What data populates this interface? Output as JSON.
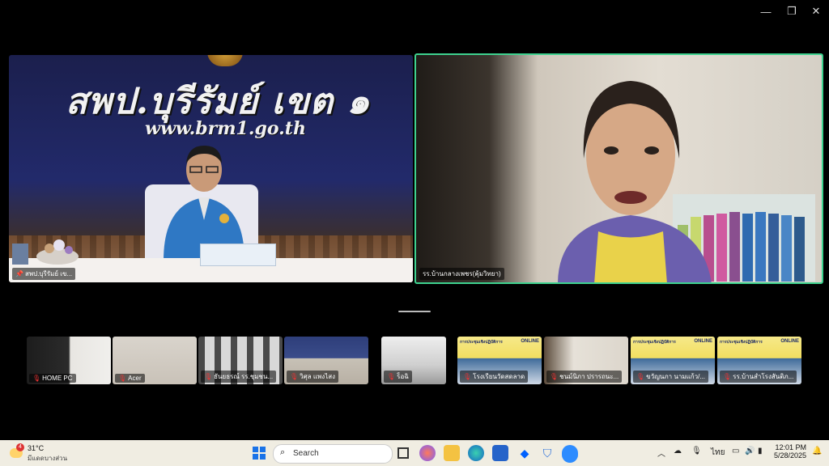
{
  "window": {
    "minimize_glyph": "—",
    "restore_glyph": "❐",
    "close_glyph": "✕"
  },
  "main_tiles": [
    {
      "participant_name": "สพป.บุรีรัมย์ เข...",
      "banner_title": "สพป.บุรีรัมย์ เขต ๑",
      "banner_url": "www.brm1.go.th",
      "pinned": true
    },
    {
      "participant_name": "รร.บ้านกลางเพชร(คุ้มวิทยา)",
      "active_speaker": true,
      "highlight_color": "#3ed28f"
    }
  ],
  "thumbnails": [
    {
      "name": "HOME PC",
      "muted": true
    },
    {
      "name": "Acer",
      "muted": true
    },
    {
      "name": "ธันยธรณ์ รร.ชุมชน...",
      "muted": true
    },
    {
      "name": "วิศุล แพงไสง",
      "muted": true
    },
    {
      "name": "ร็อฉิ",
      "muted": true
    },
    {
      "name": "โรงเรียนวัดสดลาด",
      "muted": true,
      "slide_title": "การประชุมเชิงปฏิบัติการ",
      "slide_badge": "ONLINE"
    },
    {
      "name": "ชนม์นิภา ปรารถนะ...",
      "muted": true
    },
    {
      "name": "ขวัญนภา นามแก้ว/...",
      "muted": true,
      "slide_title": "การประชุมเชิงปฏิบัติการ",
      "slide_badge": "ONLINE"
    },
    {
      "name": "รร.บ้านสำโรงสันติภ...",
      "muted": true,
      "slide_title": "การประชุมเชิงปฏิบัติการ",
      "slide_badge": "ONLINE"
    }
  ],
  "taskbar": {
    "weather_temp": "31°C",
    "weather_desc": "มีแดดบางส่วน",
    "weather_badge": "4",
    "search_placeholder": "Search",
    "input_language": "ไทย",
    "time": "12:01 PM",
    "date": "5/28/2025",
    "pinned_apps": [
      "task-view",
      "copilot",
      "file-explorer",
      "edge",
      "store",
      "dropbox",
      "defender",
      "zoom"
    ]
  }
}
